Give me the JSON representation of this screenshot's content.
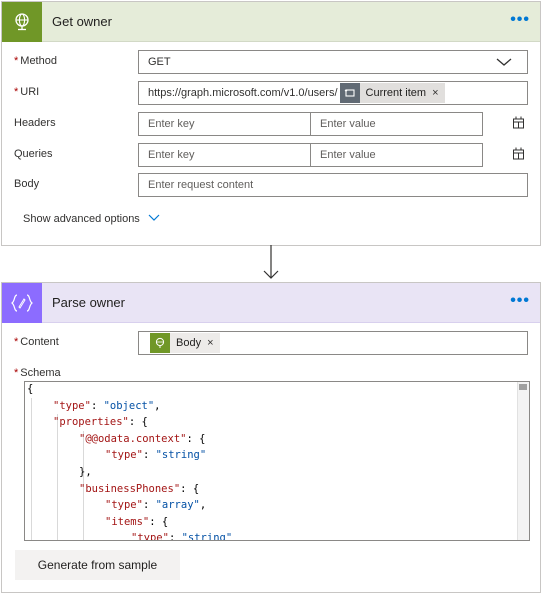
{
  "http_action": {
    "title": "Get owner",
    "more_label": "•••",
    "method_label": "Method",
    "method_value": "GET",
    "uri_label": "URI",
    "uri_value": "https://graph.microsoft.com/v1.0/users/",
    "uri_token": "Current item",
    "token_remove": "×",
    "headers_label": "Headers",
    "queries_label": "Queries",
    "body_label": "Body",
    "key_placeholder": "Enter key",
    "value_placeholder": "Enter value",
    "body_placeholder": "Enter request content",
    "advanced_label": "Show advanced options"
  },
  "parse_action": {
    "title": "Parse owner",
    "more_label": "•••",
    "content_label": "Content",
    "content_token": "Body",
    "token_remove": "×",
    "schema_label": "Schema",
    "schema_lines": [
      {
        "indent": 0,
        "key": "",
        "rest": "{"
      },
      {
        "indent": 1,
        "key": "\"type\"",
        "sep": ": ",
        "str": "\"object\"",
        "rest": ","
      },
      {
        "indent": 1,
        "key": "\"properties\"",
        "sep": ": ",
        "str": "",
        "rest": "{"
      },
      {
        "indent": 2,
        "key": "\"@@odata.context\"",
        "sep": ": ",
        "str": "",
        "rest": "{"
      },
      {
        "indent": 3,
        "key": "\"type\"",
        "sep": ": ",
        "str": "\"string\"",
        "rest": ""
      },
      {
        "indent": 2,
        "key": "",
        "rest": "},"
      },
      {
        "indent": 2,
        "key": "\"businessPhones\"",
        "sep": ": ",
        "str": "",
        "rest": "{"
      },
      {
        "indent": 3,
        "key": "\"type\"",
        "sep": ": ",
        "str": "\"array\"",
        "rest": ","
      },
      {
        "indent": 3,
        "key": "\"items\"",
        "sep": ": ",
        "str": "",
        "rest": "{"
      },
      {
        "indent": 4,
        "key": "\"type\"",
        "sep": ": ",
        "str": "\"string\"",
        "rest": ""
      }
    ],
    "generate_button": "Generate from sample"
  },
  "colors": {
    "http_accent": "#709727",
    "parse_accent": "#8c6cff",
    "link_blue": "#0078d4"
  },
  "icons": [
    "globe-icon",
    "expression-icon",
    "more-icon",
    "chevron-down-icon",
    "table-icon",
    "arrow-down-icon"
  ]
}
